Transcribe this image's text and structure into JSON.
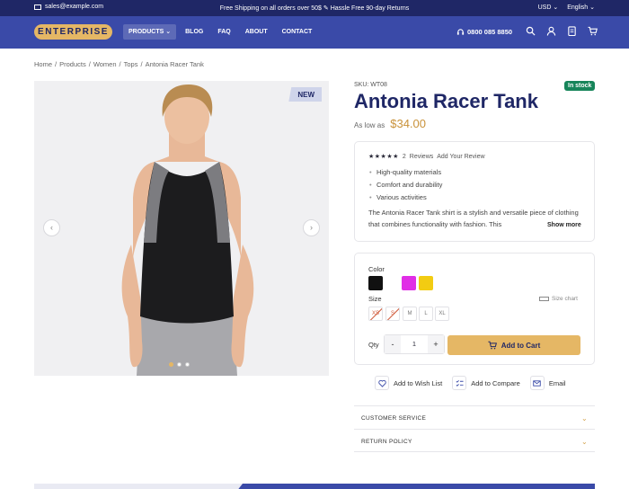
{
  "topbar": {
    "email": "sales@example.com",
    "shipping": "Free Shipping on all orders over 50$",
    "returns": "Hassle Free 90-day Returns",
    "currency": "USD",
    "language": "English"
  },
  "header": {
    "logo": "ENTERPRISE",
    "nav": [
      "PRODUCTS",
      "BLOG",
      "FAQ",
      "ABOUT",
      "CONTACT"
    ],
    "phone": "0800 085 8850"
  },
  "breadcrumb": [
    "Home",
    "Products",
    "Women",
    "Tops",
    "Antonia Racer Tank"
  ],
  "product": {
    "badge": "NEW",
    "sku": "SKU: WT08",
    "stock": "In stock",
    "title": "Antonia Racer Tank",
    "price_label": "As low as",
    "price": "$34.00",
    "rating": 4.5,
    "stars": "★★★★★",
    "reviews_count": "2",
    "reviews_label": "Reviews",
    "add_review": "Add Your Review",
    "features": [
      "High-quality materials",
      "Comfort and durability",
      "Various activities"
    ],
    "description": "The Antonia Racer Tank shirt is a stylish and versatile piece of clothing that combines functionality with fashion. This",
    "show_more": "Show more"
  },
  "options": {
    "color_label": "Color",
    "colors": [
      "#111111",
      "#ffffff",
      "#e02ee6",
      "#f2cc12"
    ],
    "size_label": "Size",
    "size_chart": "Size chart",
    "sizes": [
      "XS",
      "S",
      "M",
      "L",
      "XL"
    ],
    "qty_label": "Qty",
    "qty_value": "1",
    "minus": "-",
    "plus": "+",
    "add_to_cart": "Add to Cart"
  },
  "actions": {
    "wishlist": "Add to Wish List",
    "compare": "Add to Compare",
    "email": "Email"
  },
  "accordion": {
    "customer_service": "CUSTOMER SERVICE",
    "return_policy": "RETURN POLICY"
  },
  "colors": {
    "navy": "#1f2766",
    "header_blue": "#3a4aa8",
    "gold": "#e5b765",
    "stock_green": "#17855a"
  }
}
